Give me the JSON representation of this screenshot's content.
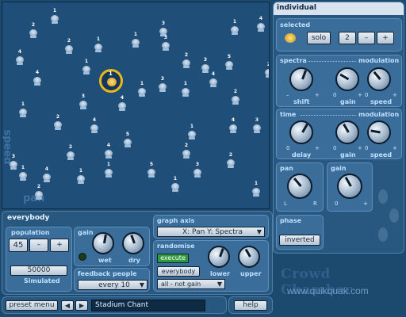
{
  "stage": {
    "side_label_speed": "speed",
    "side_label_pan": "pan",
    "people": [
      "1",
      "2",
      "3",
      "1",
      "4",
      "2",
      "1",
      "3",
      "1",
      "4",
      "1",
      "2",
      "3",
      "5",
      "2",
      "4",
      "4",
      "3",
      "1",
      "1",
      "2",
      "3",
      "4",
      "1",
      "2",
      "4",
      "4",
      "3",
      "1",
      "5",
      "4",
      "2",
      "2",
      "3",
      "2",
      "1",
      "4",
      "1",
      "5",
      "3",
      "1",
      "2",
      "1",
      "1",
      "3",
      "2",
      "1",
      "1",
      "1",
      "3",
      "1"
    ],
    "selected_person_number": "1"
  },
  "individual": {
    "title": "individual",
    "selected_label": "selected",
    "solo_label": "solo",
    "selected_value": "2",
    "minus_label": "–",
    "plus_label": "+",
    "spectra_label": "spectra",
    "modulation_label": "modulation",
    "shift_label": "shift",
    "gain_label": "gain",
    "speed_label": "speed",
    "time_label": "time",
    "delay_label": "delay",
    "pan_label": "pan",
    "pan_l": "L",
    "pan_r": "R",
    "min_sign": "–",
    "plus_sign": "+",
    "zero_sign": "0",
    "phase_label": "phase",
    "phase_value": "inverted"
  },
  "everybody": {
    "title": "everybody",
    "population_label": "population",
    "population_value": "45",
    "minus_label": "–",
    "plus_label": "+",
    "simulated_value": "50000",
    "simulated_label": "Simulated",
    "gain_label": "gain",
    "wet_label": "wet",
    "dry_label": "dry",
    "feedback_label": "feedback people",
    "feedback_value": "every 10",
    "graph_axis_label": "graph axis",
    "graph_axis_value": "X: Pan   Y: Spectra",
    "randomise_label": "randomise",
    "execute_label": "execute",
    "who_value": "everybody",
    "what_value": "all - not gain",
    "lower_label": "lower",
    "upper_label": "upper"
  },
  "bottom": {
    "preset_menu": "preset menu",
    "prev": "◀",
    "next": "▶",
    "preset_name": "Stadium Chant",
    "help": "help"
  },
  "brand": {
    "name": "Crowd Chamber",
    "url": "www.quikquak.com"
  }
}
